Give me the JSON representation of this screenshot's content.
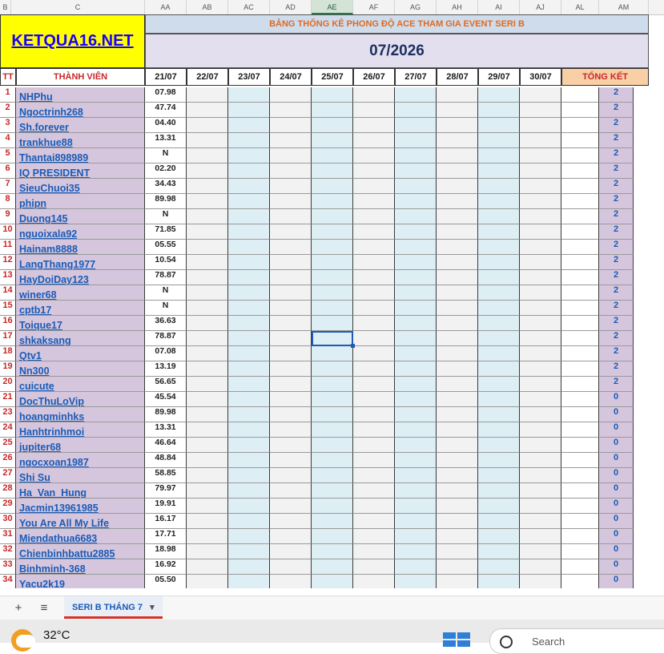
{
  "columns": [
    {
      "label": "B",
      "sel": false
    },
    {
      "label": "C",
      "sel": false
    },
    {
      "label": "AA",
      "sel": false
    },
    {
      "label": "AB",
      "sel": false
    },
    {
      "label": "AC",
      "sel": false
    },
    {
      "label": "AD",
      "sel": false
    },
    {
      "label": "AE",
      "sel": true
    },
    {
      "label": "AF",
      "sel": false
    },
    {
      "label": "AG",
      "sel": false
    },
    {
      "label": "AH",
      "sel": false
    },
    {
      "label": "AI",
      "sel": false
    },
    {
      "label": "AJ",
      "sel": false
    },
    {
      "label": "AL",
      "sel": false
    },
    {
      "label": "AM",
      "sel": false
    }
  ],
  "header": {
    "logo": "KETQUA16.NET",
    "banner": "BẢNG THỐNG KÊ PHONG ĐỘ ACE THAM GIA EVENT SERI B",
    "month": "07/2026",
    "tt": "TT",
    "member_col": "THÀNH VIÊN",
    "dates": [
      "21/07",
      "22/07",
      "23/07",
      "24/07",
      "25/07",
      "26/07",
      "27/07",
      "28/07",
      "29/07",
      "30/07"
    ],
    "summary": "TỔNG KẾT"
  },
  "rows": [
    {
      "tt": "1",
      "name": "NHPhu",
      "d1": "07.98",
      "score": "2"
    },
    {
      "tt": "2",
      "name": "Ngoctrinh268",
      "d1": "47.74",
      "score": "2"
    },
    {
      "tt": "3",
      "name": "Sh.forever",
      "d1": "04.40",
      "score": "2"
    },
    {
      "tt": "4",
      "name": "trankhue88",
      "d1": "13.31",
      "score": "2"
    },
    {
      "tt": "5",
      "name": "Thantai898989",
      "d1": "N",
      "score": "2"
    },
    {
      "tt": "6",
      "name": "IQ PRESIDENT",
      "d1": "02.20",
      "score": "2"
    },
    {
      "tt": "7",
      "name": "SieuChuoi35",
      "d1": "34.43",
      "score": "2"
    },
    {
      "tt": "8",
      "name": "phipn",
      "d1": "89.98",
      "score": "2"
    },
    {
      "tt": "9",
      "name": "Duong145",
      "d1": "N",
      "score": "2"
    },
    {
      "tt": "10",
      "name": "nguoixala92",
      "d1": "71.85",
      "score": "2"
    },
    {
      "tt": "11",
      "name": "Hainam8888",
      "d1": "05.55",
      "score": "2"
    },
    {
      "tt": "12",
      "name": "LangThang1977",
      "d1": "10.54",
      "score": "2"
    },
    {
      "tt": "13",
      "name": "HayDoiDay123",
      "d1": "78.87",
      "score": "2"
    },
    {
      "tt": "14",
      "name": "winer68",
      "d1": "N",
      "score": "2"
    },
    {
      "tt": "15",
      "name": "cptb17",
      "d1": "N",
      "score": "2"
    },
    {
      "tt": "16",
      "name": "Toique17",
      "d1": "36.63",
      "score": "2"
    },
    {
      "tt": "17",
      "name": "shkaksang",
      "d1": "78.87",
      "score": "2"
    },
    {
      "tt": "18",
      "name": "Qtv1",
      "d1": "07.08",
      "score": "2"
    },
    {
      "tt": "19",
      "name": "Nn300",
      "d1": "13.19",
      "score": "2"
    },
    {
      "tt": "20",
      "name": "cuicute",
      "d1": "56.65",
      "score": "2"
    },
    {
      "tt": "21",
      "name": "DocThuLoVip",
      "d1": "45.54",
      "score": "0"
    },
    {
      "tt": "23",
      "name": "hoangminhks",
      "d1": "89.98",
      "score": "0"
    },
    {
      "tt": "24",
      "name": "Hanhtrinhmoi",
      "d1": "13.31",
      "score": "0"
    },
    {
      "tt": "25",
      "name": "jupiter68",
      "d1": "46.64",
      "score": "0"
    },
    {
      "tt": "26",
      "name": "ngocxoan1987",
      "d1": "48.84",
      "score": "0"
    },
    {
      "tt": "27",
      "name": "Shi Su",
      "d1": "58.85",
      "score": "0"
    },
    {
      "tt": "28",
      "name": "Ha_Van_Hung",
      "d1": "79.97",
      "score": "0"
    },
    {
      "tt": "29",
      "name": "Jacmin13961985",
      "d1": "19.91",
      "score": "0"
    },
    {
      "tt": "30",
      "name": "You Are All My Life",
      "d1": "16.17",
      "score": "0"
    },
    {
      "tt": "31",
      "name": "Miendathua6683",
      "d1": "17.71",
      "score": "0"
    },
    {
      "tt": "32",
      "name": "Chienbinhbattu2885",
      "d1": "18.98",
      "score": "0"
    },
    {
      "tt": "33",
      "name": "Binhminh-368",
      "d1": "16.92",
      "score": "0"
    },
    {
      "tt": "34",
      "name": "Yacu2k19",
      "d1": "05.50",
      "score": "0"
    }
  ],
  "tabs": {
    "add": "+",
    "menu": "≡",
    "sheet": "SERI B THÁNG 7",
    "dropdown": "▾"
  },
  "taskbar": {
    "temperature": "32°C",
    "search_placeholder": "Search",
    "weather_icon": "weather-icon",
    "start_icon": "windows-start-icon",
    "search_icon": "search-icon"
  }
}
